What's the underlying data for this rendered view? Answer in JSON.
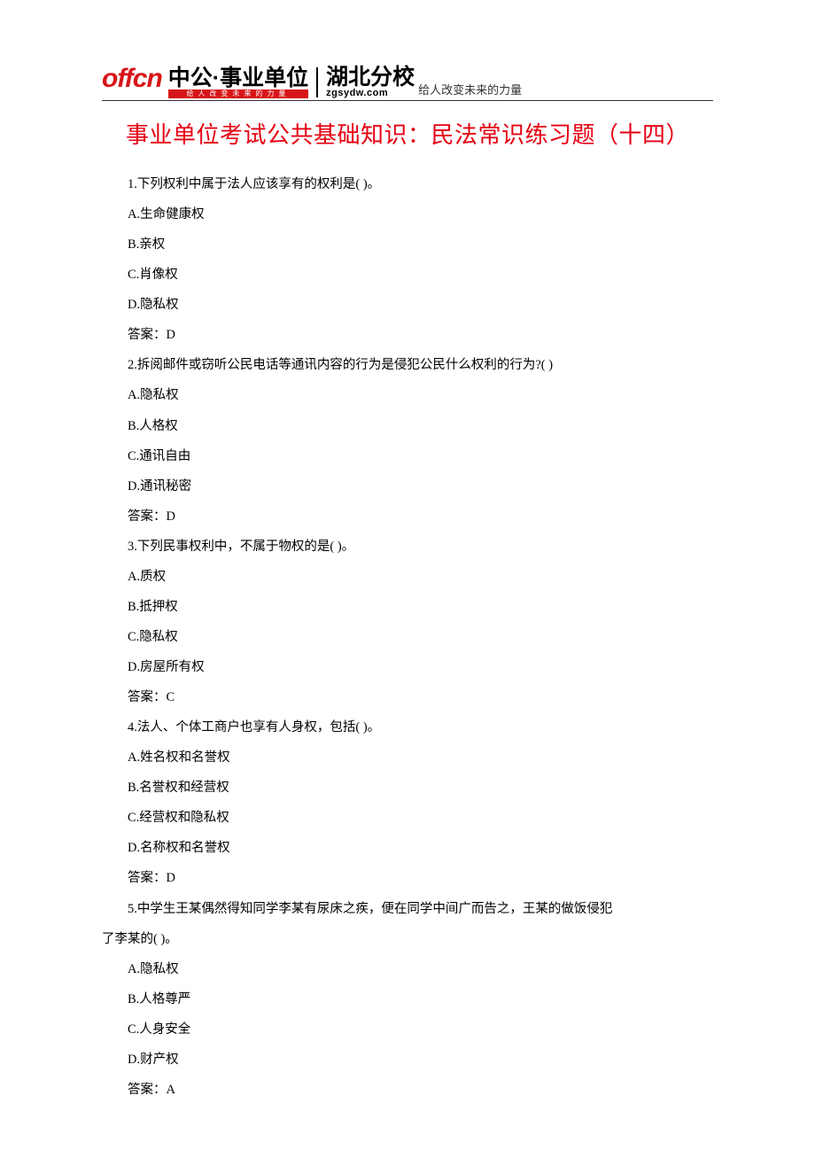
{
  "header": {
    "logo_text": "offcn",
    "brand_main": "中公·事业单位",
    "brand_sub": "给人改变未来的力量",
    "hubei_main": "湖北分校",
    "hubei_sub": "zgsydw.com",
    "slogan": "给人改变未来的力量"
  },
  "title": "事业单位考试公共基础知识：民法常识练习题（十四）",
  "questions": [
    {
      "stem": "1.下列权利中属于法人应该享有的权利是( )。",
      "options": [
        "A.生命健康权",
        "B.亲权",
        "C.肖像权",
        "D.隐私权"
      ],
      "answer": "答案：D"
    },
    {
      "stem": "2.拆阅邮件或窃听公民电话等通讯内容的行为是侵犯公民什么权利的行为?( )",
      "options": [
        "A.隐私权",
        "B.人格权",
        "C.通讯自由",
        "D.通讯秘密"
      ],
      "answer": "答案：D"
    },
    {
      "stem": "3.下列民事权利中，不属于物权的是( )。",
      "options": [
        "A.质权",
        "B.抵押权",
        "C.隐私权",
        "D.房屋所有权"
      ],
      "answer": "答案：C"
    },
    {
      "stem": "4.法人、个体工商户也享有人身权，包括( )。",
      "options": [
        "A.姓名权和名誉权",
        "B.名誉权和经营权",
        "C.经营权和隐私权",
        "D.名称权和名誉权"
      ],
      "answer": "答案：D"
    },
    {
      "stem": "5.中学生王某偶然得知同学李某有尿床之疾，便在同学中间广而告之，王某的做饭侵犯",
      "stem_cont": "了李某的( )。",
      "options": [
        "A.隐私权",
        "B.人格尊严",
        "C.人身安全",
        "D.财产权"
      ],
      "answer": "答案：A"
    }
  ]
}
